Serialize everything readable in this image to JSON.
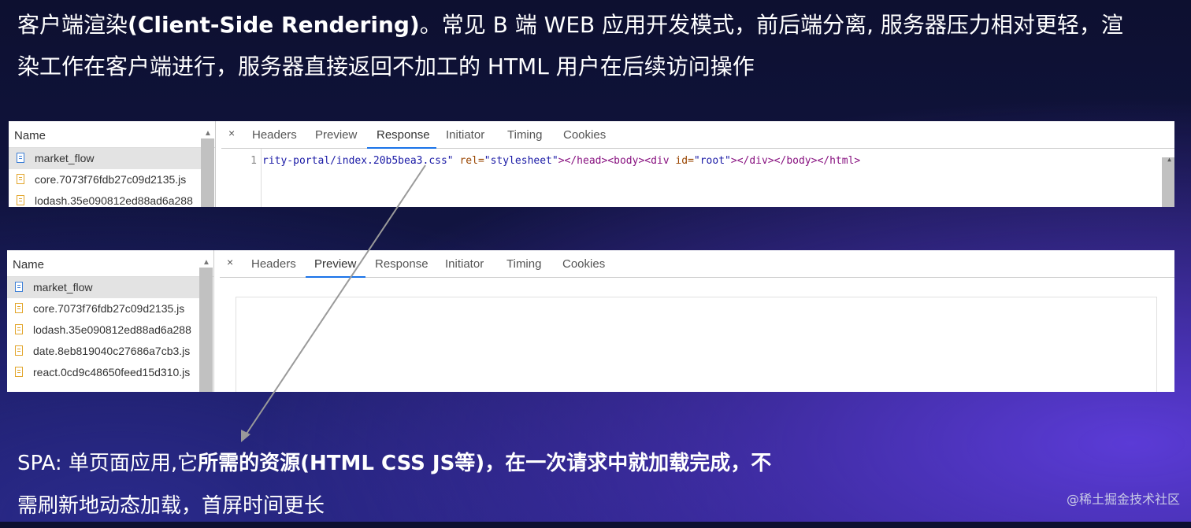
{
  "heading": {
    "line1_a": "客户端渲染",
    "line1_b": "(Client-Side Rendering)",
    "line1_c": "。常见 B 端 WEB 应用开发模式，前后端分离, 服务器压力相对更轻，渲",
    "line2": "染工作在客户端进行，服务器直接返回不加工的 HTML 用户在后续访问操作"
  },
  "devtools_top": {
    "name_header": "Name",
    "files": [
      "market_flow",
      "core.7073f76fdb27c09d2135.js",
      "lodash.35e090812ed88ad6a288"
    ],
    "close": "×",
    "tabs": [
      "Headers",
      "Preview",
      "Response",
      "Initiator",
      "Timing",
      "Cookies"
    ],
    "active_tab": "Response",
    "line_number": "1",
    "code": {
      "s1": "rity-portal/index.20b5bea3.css\"",
      "s2": " rel=",
      "s3": "\"stylesheet\"",
      "s4": "></head><body><div ",
      "s5": "id=",
      "s6": "\"root\"",
      "s7": "></div></body></html>"
    }
  },
  "devtools_bottom": {
    "name_header": "Name",
    "files": [
      "market_flow",
      "core.7073f76fdb27c09d2135.js",
      "lodash.35e090812ed88ad6a288",
      "date.8eb819040c27686a7cb3.js",
      "react.0cd9c48650feed15d310.js"
    ],
    "close": "×",
    "tabs": [
      "Headers",
      "Preview",
      "Response",
      "Initiator",
      "Timing",
      "Cookies"
    ],
    "active_tab": "Preview"
  },
  "spa": {
    "line1_a": "SPA: 单页面应用,它",
    "line1_b": "所需的资源(HTML CSS JS等)，在一次请求中就加载完成，不",
    "line2": "需刷新地动态加载，首屏时间更长"
  },
  "brand": "@稀土掘金技术社区",
  "colors": {
    "accent_tab": "#1a73e8",
    "background": "#121545"
  }
}
